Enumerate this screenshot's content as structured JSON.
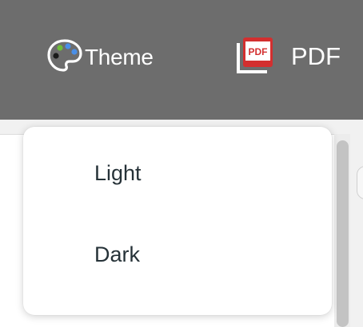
{
  "toolbar": {
    "theme": {
      "label": "Theme",
      "icon": "palette-icon"
    },
    "pdf": {
      "label": "PDF",
      "icon": "pdf-icon"
    }
  },
  "theme_menu": {
    "items": [
      {
        "label": "Light"
      },
      {
        "label": "Dark"
      }
    ]
  },
  "colors": {
    "toolbar_bg": "#6d6d6d",
    "menu_text": "#263238",
    "pdf_red": "#d32f2f"
  }
}
